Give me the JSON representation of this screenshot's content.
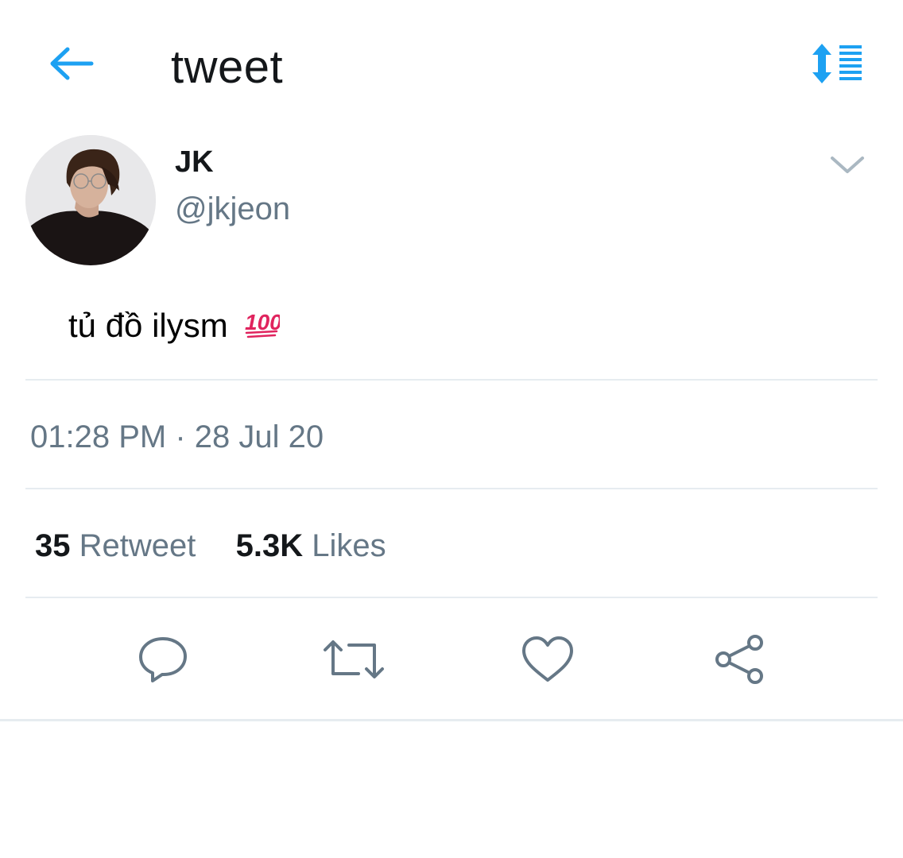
{
  "header": {
    "title": "tweet",
    "back_icon": "arrow-left-icon",
    "sort_icon": "sort-list-icon",
    "accent_color": "#1da1f2"
  },
  "author": {
    "display_name": "JK",
    "handle": "@jkjeon",
    "avatar_icon": "avatar",
    "menu_icon": "chevron-down-icon"
  },
  "tweet": {
    "text": "tủ đồ ilysm",
    "emoji_icon": "hundred-points-icon"
  },
  "meta": {
    "timestamp": "01:28 PM · 28 Jul 20"
  },
  "stats": {
    "retweets_count": "35",
    "retweets_label": "Retweet",
    "likes_count": "5.3K",
    "likes_label": "Likes"
  },
  "actions": [
    {
      "name": "reply",
      "icon": "reply-icon"
    },
    {
      "name": "retweet",
      "icon": "retweet-icon"
    },
    {
      "name": "like",
      "icon": "heart-icon"
    },
    {
      "name": "share",
      "icon": "share-icon"
    }
  ],
  "colors": {
    "text_primary": "#14171a",
    "text_secondary": "#657786",
    "divider": "#e6ecf0",
    "icon_gray": "#657786",
    "emoji_red": "#e0245e"
  }
}
